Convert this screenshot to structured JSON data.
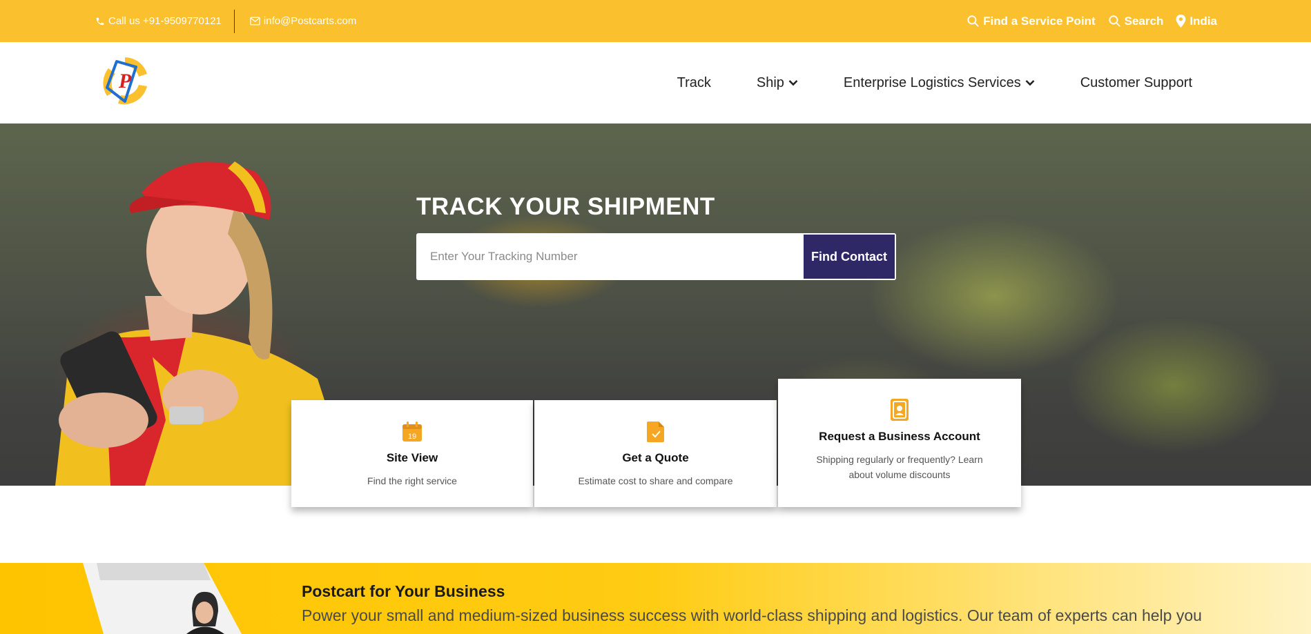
{
  "colors": {
    "topbar_bg": "#fbc02d",
    "accent_dark": "#2e2866",
    "icon_orange": "#f5a623",
    "business_bg": "#ffc400"
  },
  "topbar": {
    "phone": {
      "icon": "phone-icon",
      "text": "Call us +91-9509770121"
    },
    "email": {
      "icon": "mail-icon",
      "text": "info@Postcarts.com"
    },
    "links": [
      {
        "icon": "search-icon",
        "label": "Find a Service Point"
      },
      {
        "icon": "search-icon",
        "label": "Search"
      },
      {
        "icon": "location-pin-icon",
        "label": "India"
      }
    ]
  },
  "nav": {
    "items": [
      {
        "label": "Track"
      },
      {
        "label": "Ship",
        "icon": "chevron-down-icon"
      },
      {
        "label": "Enterprise Logistics Services",
        "icon": "chevron-down-icon"
      },
      {
        "label": "Customer Support"
      }
    ]
  },
  "hero": {
    "title": "TRACK YOUR SHIPMENT",
    "tracking_placeholder": "Enter Your Tracking Number",
    "button_label": "Find Contact"
  },
  "cards": [
    {
      "icon": "calendar-icon",
      "icon_text": "19",
      "title": "Site View",
      "desc": "Find the right service"
    },
    {
      "icon": "document-check-icon",
      "title": "Get a Quote",
      "desc": "Estimate cost to share and compare"
    },
    {
      "icon": "badge-icon",
      "title": "Request a Business Account",
      "desc": "Shipping regularly or frequently? Learn about volume discounts"
    }
  ],
  "business": {
    "title": "Postcart for Your Business",
    "text": "Power your small and medium-sized business success with world-class shipping and logistics. Our team of experts can help you"
  }
}
